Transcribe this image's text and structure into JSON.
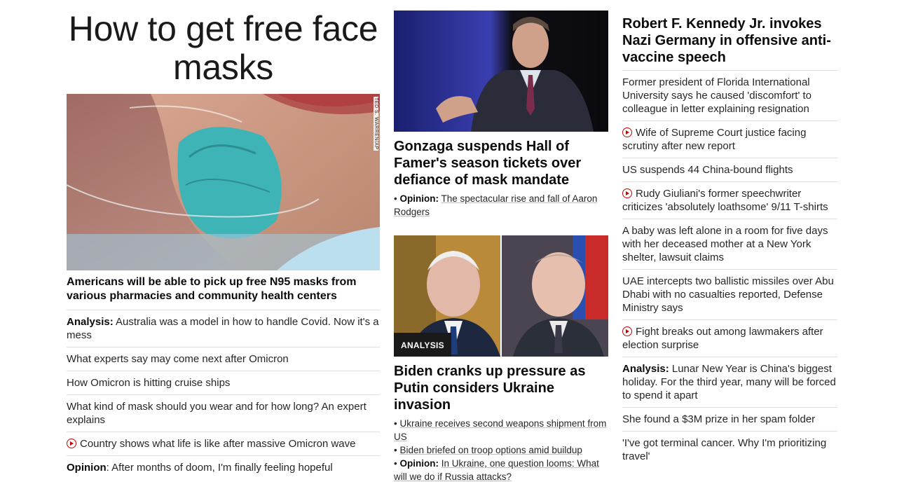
{
  "left": {
    "title": "How to get free face masks",
    "image_credit": "TED S. WARREN/AP",
    "lead_headline": "Americans will be able to pick up free N95 masks from various pharmacies and community health centers",
    "items": [
      {
        "prefix": "Analysis:",
        "text": " Australia was a model in how to handle Covid. Now it's a mess",
        "video": false
      },
      {
        "prefix": "",
        "text": "What experts say may come next after Omicron",
        "video": false
      },
      {
        "prefix": "",
        "text": "How Omicron is hitting cruise ships",
        "video": false
      },
      {
        "prefix": "",
        "text": "What kind of mask should you wear and for how long? An expert explains",
        "video": false
      },
      {
        "prefix": "",
        "text": "Country shows what life is like after massive Omicron wave",
        "video": true
      },
      {
        "prefix": "Opinion",
        "text": ": After months of doom, I'm finally feeling hopeful",
        "video": false
      }
    ]
  },
  "middle": {
    "story1": {
      "headline": "Gonzaga suspends Hall of Famer's season tickets over defiance of mask mandate",
      "sub_prefix": "Opinion:",
      "sub_text": "The spectacular rise and fall of Aaron Rodgers"
    },
    "story2": {
      "badge": "ANALYSIS",
      "headline": "Biden cranks up pressure as Putin considers Ukraine invasion",
      "links": [
        {
          "prefix": "",
          "text": "Ukraine receives second weapons shipment from US"
        },
        {
          "prefix": "",
          "text": "Biden briefed on troop options amid buildup"
        },
        {
          "prefix": "Opinion:",
          "text": "In Ukraine, one question looms: What will we do if Russia attacks?"
        }
      ]
    }
  },
  "right": {
    "headline": "Robert F. Kennedy Jr. invokes Nazi Germany in offensive anti-vaccine speech",
    "items": [
      {
        "prefix": "",
        "text": "Former president of Florida International University says he caused 'discomfort' to colleague in letter explaining resignation",
        "video": false
      },
      {
        "prefix": "",
        "text": "Wife of Supreme Court justice facing scrutiny after new report",
        "video": true
      },
      {
        "prefix": "",
        "text": "US suspends 44 China-bound flights",
        "video": false
      },
      {
        "prefix": "",
        "text": "Rudy Giuliani's former speechwriter criticizes 'absolutely loathsome' 9/11 T-shirts",
        "video": true
      },
      {
        "prefix": "",
        "text": "A baby was left alone in a room for five days with her deceased mother at a New York shelter, lawsuit claims",
        "video": false
      },
      {
        "prefix": "",
        "text": "UAE intercepts two ballistic missiles over Abu Dhabi with no casualties reported, Defense Ministry says",
        "video": false
      },
      {
        "prefix": "",
        "text": "Fight breaks out among lawmakers after election surprise",
        "video": true
      },
      {
        "prefix": "Analysis:",
        "text": " Lunar New Year is China's biggest holiday. For the third year, many will be forced to spend it apart",
        "video": false
      },
      {
        "prefix": "",
        "text": "She found a $3M prize in her spam folder",
        "video": false
      },
      {
        "prefix": "",
        "text": "'I've got terminal cancer. Why I'm prioritizing travel'",
        "video": false
      }
    ]
  },
  "colors": {
    "accent_red": "#cc0000",
    "divider": "#dedede",
    "badge_bg": "#1a1a1a"
  }
}
